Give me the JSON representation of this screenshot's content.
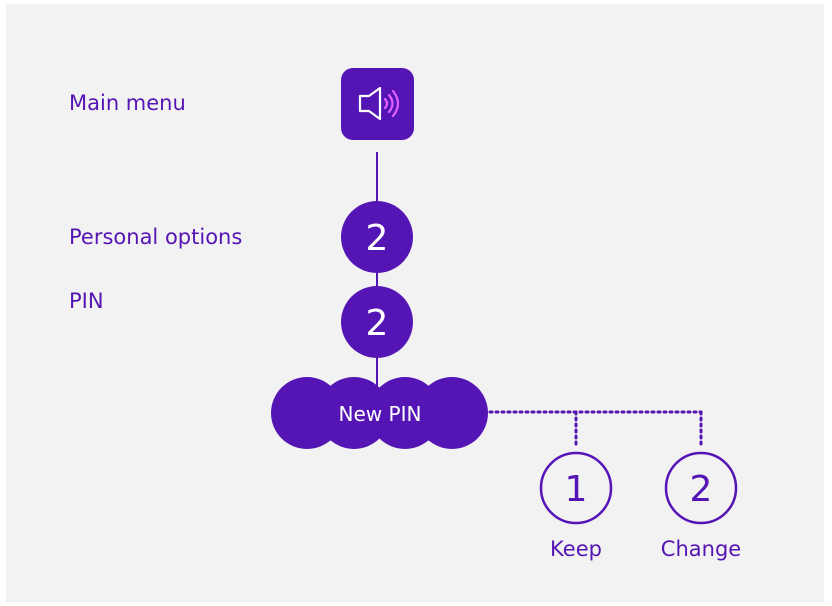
{
  "colors": {
    "background": "#f2f2f2",
    "primary": "#5514b4",
    "accent": "#e060ff",
    "white": "#ffffff"
  },
  "levels": {
    "main_menu": {
      "label": "Main menu",
      "icon": "speaker-icon"
    },
    "personal_options": {
      "label": "Personal options",
      "key": "2"
    },
    "pin": {
      "label": "PIN",
      "key": "2"
    },
    "new_pin": {
      "label": "New PIN"
    }
  },
  "options": [
    {
      "key": "1",
      "label": "Keep"
    },
    {
      "key": "2",
      "label": "Change"
    }
  ]
}
